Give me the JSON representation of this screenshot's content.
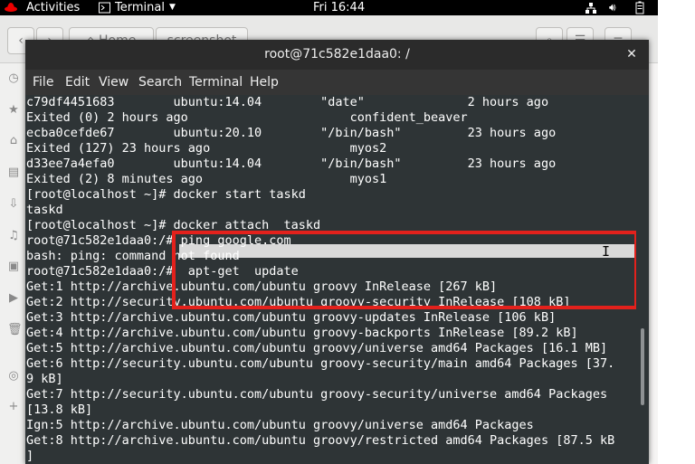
{
  "topbar": {
    "activities": "Activities",
    "app_menu": "Terminal",
    "clock": "Fri 16:44"
  },
  "filemanager": {
    "path_home": "Home",
    "path_folder": "screenshot"
  },
  "terminal": {
    "title": "root@71c582e1daa0: /",
    "menu": [
      "File",
      "Edit",
      "View",
      "Search",
      "Terminal",
      "Help"
    ],
    "lines": [
      "c79df4451683        ubuntu:14.04        \"date\"              2 hours ago",
      "Exited (0) 2 hours ago                      confident_beaver",
      "ecba0cefde67        ubuntu:20.10        \"/bin/bash\"         23 hours ago",
      "Exited (127) 23 hours ago                   myos2",
      "d33ee7a4efa0        ubuntu:14.04        \"/bin/bash\"         23 hours ago",
      "Exited (2) 8 minutes ago                    myos1",
      "[root@localhost ~]# docker start taskd",
      "taskd",
      "[root@localhost ~]# docker attach  taskd",
      "root@71c582e1daa0:/# ping google.com",
      "bash: ping: command not found",
      "root@71c582e1daa0:/#  apt-get  update",
      "Get:1 http://archive.ubuntu.com/ubuntu groovy InRelease [267 kB]",
      "Get:2 http://security.ubuntu.com/ubuntu groovy-security InRelease [108 kB]",
      "Get:3 http://archive.ubuntu.com/ubuntu groovy-updates InRelease [106 kB]",
      "Get:4 http://archive.ubuntu.com/ubuntu groovy-backports InRelease [89.2 kB]",
      "Get:5 http://archive.ubuntu.com/ubuntu groovy/universe amd64 Packages [16.1 MB]",
      "Get:6 http://security.ubuntu.com/ubuntu groovy-security/main amd64 Packages [37.",
      "9 kB]",
      "Get:7 http://security.ubuntu.com/ubuntu groovy-security/universe amd64 Packages",
      "[13.8 kB]",
      "Ign:5 http://archive.ubuntu.com/ubuntu groovy/universe amd64 Packages",
      "Get:8 http://archive.ubuntu.com/ubuntu groovy/restricted amd64 Packages [87.5 kB",
      "]"
    ]
  },
  "colors": {
    "terminal_bg": "#2e3436",
    "annotation_red": "#e3211c",
    "selection": "#d9d9d9"
  }
}
